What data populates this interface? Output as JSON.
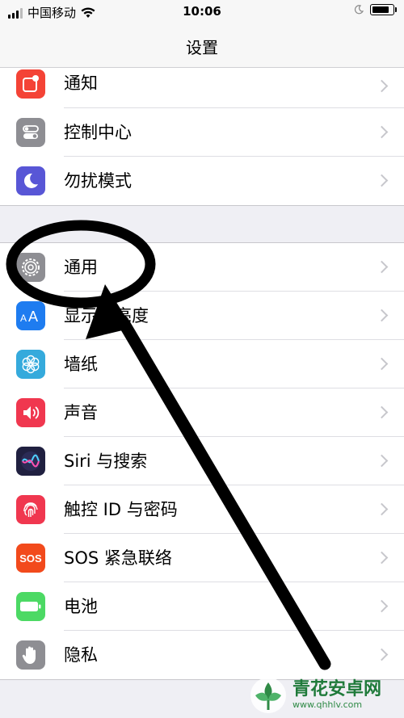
{
  "status_bar": {
    "carrier": "中国移动",
    "time": "10:06",
    "battery_level": 0.85
  },
  "nav": {
    "title": "设置"
  },
  "group1": [
    {
      "label": "通知",
      "icon": "notifications-icon",
      "color": "#f44336"
    },
    {
      "label": "控制中心",
      "icon": "control-center-icon",
      "color": "#8e8e93"
    },
    {
      "label": "勿扰模式",
      "icon": "moon-icon",
      "color": "#5856d6"
    }
  ],
  "group2": [
    {
      "label": "通用",
      "icon": "gear-icon",
      "color": "#8e8e93"
    },
    {
      "label": "显示与亮度",
      "icon": "display-aa-icon",
      "color": "#1e7cf0"
    },
    {
      "label": "墙纸",
      "icon": "wallpaper-flower-icon",
      "color": "#35aadc"
    },
    {
      "label": "声音",
      "icon": "speaker-icon",
      "color": "#f0374f"
    },
    {
      "label": "Siri 与搜索",
      "icon": "siri-icon",
      "color": "#202040"
    },
    {
      "label": "触控 ID 与密码",
      "icon": "fingerprint-icon",
      "color": "#f0374f"
    },
    {
      "label": "SOS 紧急联络",
      "icon": "sos-icon",
      "color": "#f24a1c",
      "icon_text": "SOS"
    },
    {
      "label": "电池",
      "icon": "battery-icon",
      "color": "#4cd964"
    },
    {
      "label": "隐私",
      "icon": "hand-icon",
      "color": "#8e8e93"
    }
  ],
  "watermark": {
    "line1": "青花安卓网",
    "line2": "www.qhhlv.com"
  },
  "annotation": {
    "color": "#000000"
  }
}
